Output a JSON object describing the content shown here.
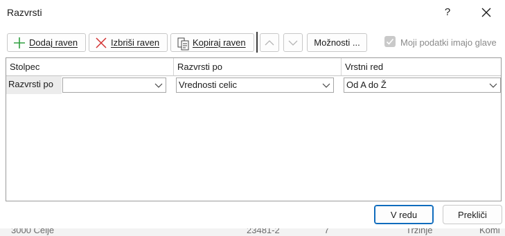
{
  "dialog": {
    "title": "Razvrsti",
    "help_label": "?"
  },
  "toolbar": {
    "add_level": "Dodaj raven",
    "delete_level": "Izbriši raven",
    "copy_level": "Kopiraj raven",
    "options": "Možnosti ...",
    "has_headers_label": "Moji podatki imajo glave",
    "has_headers_checked": true,
    "has_headers_enabled": false
  },
  "grid": {
    "headers": [
      "Stolpec",
      "Razvrsti po",
      "Vrstni red"
    ],
    "rows": [
      {
        "label": "Razvrsti po",
        "column": "",
        "sort_on": "Vrednosti celic",
        "order": "Od A do Ž"
      }
    ]
  },
  "footer": {
    "ok": "V redu",
    "cancel": "Prekliči"
  },
  "background": {
    "row_fragments": [
      "3000 Celje",
      "23481-2",
      "7",
      "Trzinje",
      "Komi"
    ]
  },
  "colors": {
    "accent": "#0f6cbd",
    "add_icon": "#2e9e3e",
    "delete_icon": "#d32f2f"
  }
}
